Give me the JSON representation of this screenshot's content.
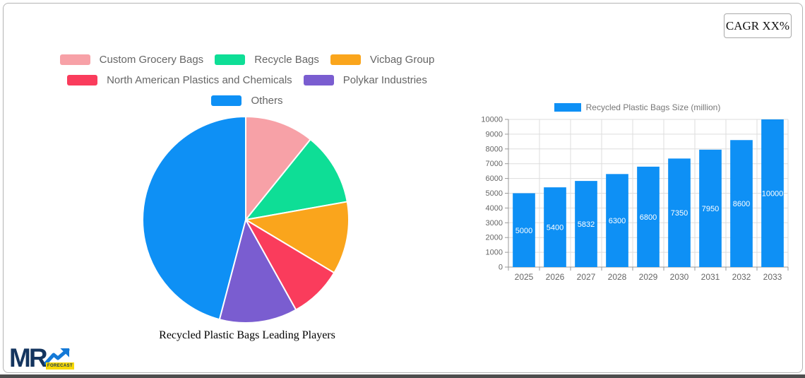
{
  "cagr_label": "CAGR XX%",
  "logo": {
    "text": "MR",
    "sub": "FORECAST"
  },
  "colors": {
    "accent_blue": "#0E90F5",
    "grid": "#dddddd",
    "axis": "#999999",
    "tick_text": "#666666",
    "legend_text": "#666666"
  },
  "chart_data": [
    {
      "type": "pie",
      "title": "Recycled Plastic Bags Leading Players",
      "labels": [
        "Custom Grocery Bags",
        "Recycle Bags",
        "Vicbag Group",
        "North American Plastics and Chemicals",
        "Polykar Industries",
        "Others"
      ],
      "values": [
        10.8,
        11.4,
        11.4,
        8.3,
        12.2,
        45.9
      ],
      "unit": "percent (estimated from slice angles)",
      "colors": [
        "#F7A1A7",
        "#0EDE96",
        "#FAA51C",
        "#FA3C5C",
        "#7A5DD0",
        "#0E90F5"
      ],
      "legend_position": "top",
      "start_angle_deg": 0,
      "direction": "clockwise"
    },
    {
      "type": "bar",
      "categories": [
        "2025",
        "2026",
        "2027",
        "2028",
        "2029",
        "2030",
        "2031",
        "2032",
        "2033"
      ],
      "series": [
        {
          "name": "Recycled Plastic Bags Size (million)",
          "values": [
            5000,
            5400,
            5832,
            6300,
            6800,
            7350,
            7950,
            8600,
            10000
          ]
        }
      ],
      "ylim": [
        0,
        10000
      ],
      "yticks": [
        0,
        1000,
        2000,
        3000,
        4000,
        5000,
        6000,
        7000,
        8000,
        9000,
        10000
      ],
      "bar_color": "#0E90F5",
      "value_label_color": "#ffffff",
      "grid": true,
      "legend_position": "top"
    }
  ]
}
